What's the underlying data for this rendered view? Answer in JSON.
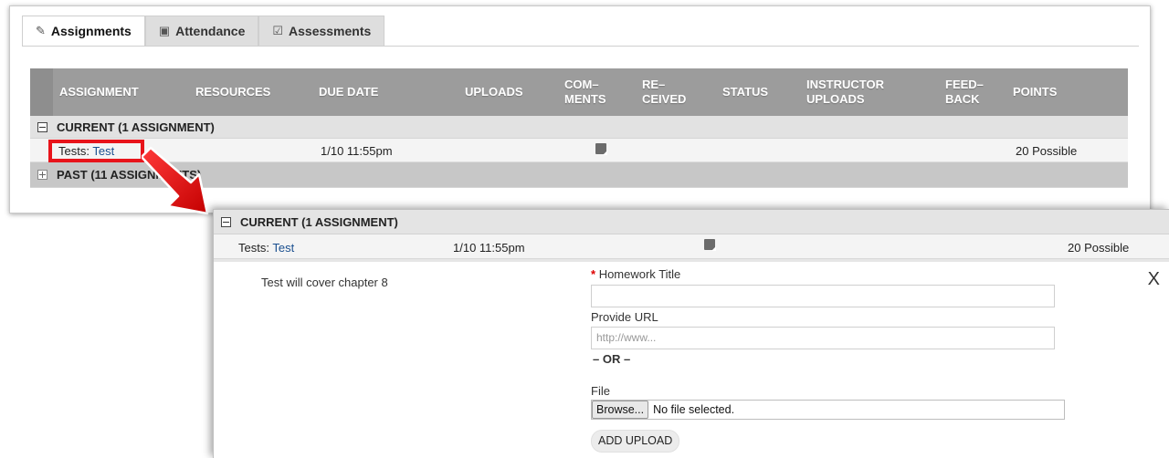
{
  "tabs": [
    {
      "label": "Assignments",
      "icon": "edit-icon",
      "active": true
    },
    {
      "label": "Attendance",
      "icon": "calendar-check-icon",
      "active": false
    },
    {
      "label": "Assessments",
      "icon": "checkbox-icon",
      "active": false
    }
  ],
  "columns": {
    "assignment": "ASSIGNMENT",
    "resources": "RESOURCES",
    "due_date": "DUE DATE",
    "uploads": "UPLOADS",
    "comments_1": "COM–",
    "comments_2": "MENTS",
    "received_1": "RE–",
    "received_2": "CEIVED",
    "status": "STATUS",
    "instructor_1": "INSTRUCTOR",
    "instructor_2": "UPLOADS",
    "feedback_1": "FEED–",
    "feedback_2": "BACK",
    "points": "POINTS"
  },
  "groups": {
    "current": "CURRENT (1 ASSIGNMENT)",
    "past": "PAST (11 ASSIGNMENTS)"
  },
  "row": {
    "type": "Tests:",
    "name": "Test",
    "due": "1/10 11:55pm",
    "points": "20 Possible"
  },
  "detail": {
    "description": "Test will cover chapter 8",
    "close": "X",
    "required_mark": "*",
    "title_label": "Homework Title",
    "title_value": "",
    "url_label": "Provide URL",
    "url_placeholder": "http://www...",
    "or_text": "– OR –",
    "file_label": "File",
    "browse": "Browse...",
    "no_file": "No file selected.",
    "add_upload": "ADD UPLOAD"
  },
  "colors": {
    "highlight": "#e8141b",
    "header_bg": "#9c9c9c",
    "link": "#1a4f8f"
  }
}
